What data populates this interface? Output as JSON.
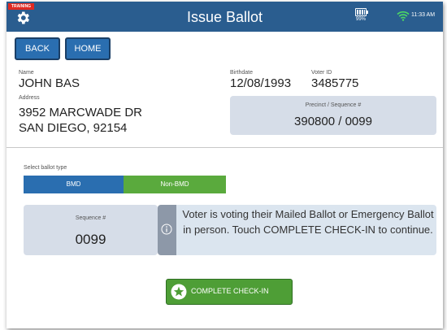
{
  "header": {
    "training_label": "TRAINING",
    "title": "Issue Ballot",
    "battery_percent": "99%",
    "time": "11:33 AM"
  },
  "nav": {
    "back_label": "BACK",
    "home_label": "HOME"
  },
  "voter": {
    "name_label": "Name",
    "name": "JOHN BAS",
    "birthdate_label": "Birthdate",
    "birthdate": "12/08/1993",
    "voter_id_label": "Voter ID",
    "voter_id": "3485775",
    "address_label": "Address",
    "address_line1": "3952 MARCWADE DR",
    "address_line2": "SAN DIEGO, 92154",
    "precinct_label": "Precinct / Sequence #",
    "precinct_value": "390800 / 0099"
  },
  "ballot": {
    "select_label": "Select ballot type",
    "options": [
      "BMD",
      "Non-BMD"
    ],
    "selected": "Non-BMD",
    "sequence_label": "Sequence #",
    "sequence_value": "0099"
  },
  "info": {
    "message": "Voter is voting their Mailed Ballot or Emergency Ballot in person. Touch COMPLETE CHECK-IN to continue."
  },
  "actions": {
    "complete_label": "COMPLETE CHECK-IN"
  },
  "colors": {
    "header_bg": "#2a5d8f",
    "primary_blue": "#2a6eb0",
    "green": "#5aaa3d",
    "training_red": "#e02a22"
  }
}
